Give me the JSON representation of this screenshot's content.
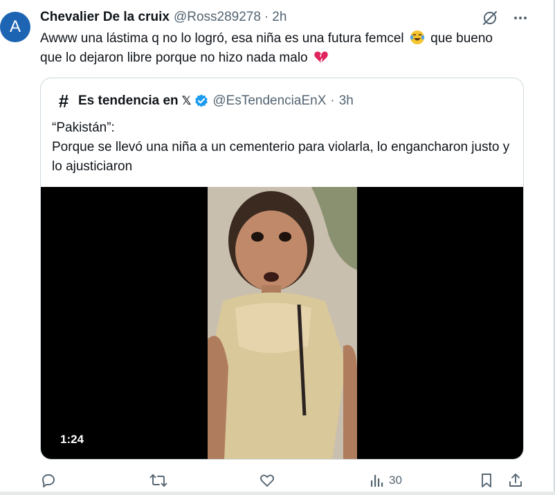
{
  "tweet": {
    "avatar_letter": "A",
    "author_name": "Chevalier De la cruix",
    "author_handle": "@Ross289278",
    "separator": "·",
    "time": "2h",
    "text_part1": "Awww una lástima q no lo logró, esa niña es una futura femcel",
    "text_part2": "que bueno que lo dejaron libre porque no hizo nada malo",
    "emojis": [
      "tears-of-joy-emoji",
      "broken-heart-emoji"
    ]
  },
  "quote": {
    "author_name": "Es tendencia en",
    "author_suffix": "𝕏",
    "author_handle": "@EsTendenciaEnX",
    "separator": "·",
    "time": "3h",
    "text_line1": "“Pakistán”:",
    "text_line2": "Porque se llevó una niña a un cementerio para violarla, lo engancharon justo y lo ajusticiaron",
    "video_duration": "1:24"
  },
  "actions": {
    "views_count": "30"
  },
  "icons": {
    "grok": "grok-icon",
    "more": "more-icon",
    "reply": "reply-icon",
    "retweet": "retweet-icon",
    "like": "like-icon",
    "views": "views-icon",
    "bookmark": "bookmark-icon",
    "share": "share-icon"
  },
  "colors": {
    "avatar_bg": "#1d64b3",
    "verified": "#1d9bf0",
    "secondary_text": "#536471"
  }
}
